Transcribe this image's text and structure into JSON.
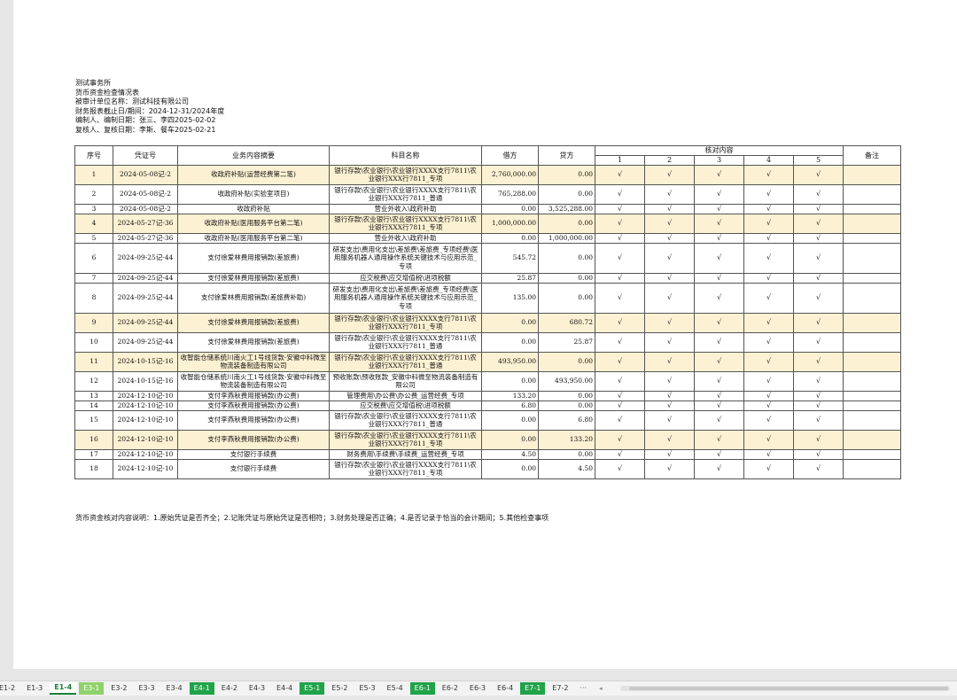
{
  "header": {
    "firm": "测试事务所",
    "title": "货币资金检查情况表",
    "entity": "被审计单位名称：测试科技有限公司",
    "period": "财务报表截止日/期间：2024-12-31/2024年度",
    "prepared": "编制人、编制日期：张三、李四2025-02-02",
    "reviewed": "复核人、复核日期：李斯、餐车2025-02-21"
  },
  "table": {
    "headers": {
      "seq": "序号",
      "voucher": "凭证号",
      "summary": "业务内容摘要",
      "account": "科目名称",
      "debit": "借方",
      "credit": "贷方",
      "check": "核对内容",
      "remark": "备注",
      "check_cols": [
        "1",
        "2",
        "3",
        "4",
        "5"
      ]
    },
    "check_mark": "√",
    "rows": [
      {
        "seq": "1",
        "voucher": "2024-05-08记-2",
        "summary": "收政府补贴(运营经费第二笔)",
        "account": "银行存款\\农业银行\\农业银行XXXX支行7811\\农业银行XXX行7811_专项",
        "debit": "2,760,000.00",
        "credit": "0.00",
        "remark": ""
      },
      {
        "seq": "2",
        "voucher": "2024-05-08记-2",
        "summary": "收政府补贴(实验室项目)",
        "account": "银行存款\\农业银行\\农业银行XXXX支行7811\\农业银行XXX行7811_普通",
        "debit": "765,288.00",
        "credit": "0.00",
        "remark": ""
      },
      {
        "seq": "3",
        "voucher": "2024-05-08记-2",
        "summary": "收政府补贴",
        "account": "营业外收入\\政府补助",
        "debit": "0.00",
        "credit": "3,525,288.00",
        "remark": ""
      },
      {
        "seq": "4",
        "voucher": "2024-05-27记-36",
        "summary": "收政府补贴(医用服务平台第二笔)",
        "account": "银行存款\\农业银行\\农业银行XXXX支行7811\\农业银行XXX行7811_专项",
        "debit": "1,000,000.00",
        "credit": "0.00",
        "remark": ""
      },
      {
        "seq": "5",
        "voucher": "2024-05-27记-36",
        "summary": "收政府补贴(医用服务平台第二笔)",
        "account": "营业外收入\\政府补助",
        "debit": "0.00",
        "credit": "1,000,000.00",
        "remark": ""
      },
      {
        "seq": "6",
        "voucher": "2024-09-25记-44",
        "summary": "支付徐爱林费用报销款(差旅费)",
        "account": "研发支出\\费用化支出\\差旅费\\差旅费_专项经费\\医用服务机器人通用操作系统关键技术与应用示范_专项",
        "debit": "545.72",
        "credit": "0.00",
        "remark": ""
      },
      {
        "seq": "7",
        "voucher": "2024-09-25记-44",
        "summary": "支付徐爱林费用报销款(差旅费)",
        "account": "应交税费\\应交增值税\\进项税额",
        "debit": "25.87",
        "credit": "0.00",
        "remark": ""
      },
      {
        "seq": "8",
        "voucher": "2024-09-25记-44",
        "summary": "支付徐爱林费用报销款(差旅费补助)",
        "account": "研发支出\\费用化支出\\差旅费\\差旅费_专项经费\\医用服务机器人通用操作系统关键技术与应用示范_专项",
        "debit": "135.00",
        "credit": "0.00",
        "remark": ""
      },
      {
        "seq": "9",
        "voucher": "2024-09-25记-44",
        "summary": "支付徐爱林费用报销款(差旅费)",
        "account": "银行存款\\农业银行\\农业银行XXXX支行7811\\农业银行XXX行7811_专项",
        "debit": "0.00",
        "credit": "680.72",
        "remark": ""
      },
      {
        "seq": "10",
        "voucher": "2024-09-25记-44",
        "summary": "支付徐爱林费用报销款(差旅费)",
        "account": "银行存款\\农业银行\\农业银行XXXX支行7811\\农业银行XXX行7811_普通",
        "debit": "0.00",
        "credit": "25.87",
        "remark": ""
      },
      {
        "seq": "11",
        "voucher": "2024-10-15记-16",
        "summary": "收智能仓储系统川南火工1号线货款-安徽中科微至物流装备制造有限公司",
        "account": "银行存款\\农业银行\\农业银行XXXX支行7811\\农业银行XXX行7811_普通",
        "debit": "493,950.00",
        "credit": "0.00",
        "remark": ""
      },
      {
        "seq": "12",
        "voucher": "2024-10-15记-16",
        "summary": "收智能仓储系统川南火工1号线货款-安徽中科微至物流装备制造有限公司",
        "account": "预收账款\\预收账款_安徽中科微至物流装备制造有限公司",
        "debit": "0.00",
        "credit": "493,950.00",
        "remark": ""
      },
      {
        "seq": "13",
        "voucher": "2024-12-10记-10",
        "summary": "支付李燕秋费用报销款(办公费)",
        "account": "管理费用\\办公费\\办公费_运营经费_专项",
        "debit": "133.20",
        "credit": "0.00",
        "remark": ""
      },
      {
        "seq": "14",
        "voucher": "2024-12-10记-10",
        "summary": "支付李燕秋费用报销款(办公费)",
        "account": "应交税费\\应交增值税\\进项税额",
        "debit": "6.80",
        "credit": "0.00",
        "remark": ""
      },
      {
        "seq": "15",
        "voucher": "2024-12-10记-10",
        "summary": "支付李燕秋费用报销款(办公费)",
        "account": "银行存款\\农业银行\\农业银行XXXX支行7811\\农业银行XXX行7811_普通",
        "debit": "0.00",
        "credit": "6.80",
        "remark": ""
      },
      {
        "seq": "16",
        "voucher": "2024-12-10记-10",
        "summary": "支付李燕秋费用报销款(办公费)",
        "account": "银行存款\\农业银行\\农业银行XXXX支行7811\\农业银行XXX行7811_专项",
        "debit": "0.00",
        "credit": "133.20",
        "remark": ""
      },
      {
        "seq": "17",
        "voucher": "2024-12-10记-10",
        "summary": "支付银行手续费",
        "account": "财务费用\\手续费\\手续费_运营经费_专项",
        "debit": "4.50",
        "credit": "0.00",
        "remark": ""
      },
      {
        "seq": "18",
        "voucher": "2024-12-10记-10",
        "summary": "支付银行手续费",
        "account": "银行存款\\农业银行\\农业银行XXXX支行7811\\农业银行XXX行7811_专项",
        "debit": "0.00",
        "credit": "4.50",
        "remark": ""
      }
    ]
  },
  "note": "货币资金核对内容说明：1.原始凭证是否齐全；2.记账凭证与原始凭证是否相符；3.财务处理是否正确；4.是否记录于恰当的会计期间；5.其他检查事项",
  "tabs": [
    "E1-2",
    "E1-3",
    "E1-4",
    "E3-1",
    "E3-2",
    "E3-3",
    "E3-4",
    "E4-1",
    "E4-2",
    "E4-3",
    "E4-4",
    "E5-1",
    "E5-2",
    "E5-3",
    "E5-4",
    "E6-1",
    "E6-2",
    "E6-3",
    "E6-4",
    "E7-1",
    "E7-2"
  ],
  "more_tabs": "···",
  "colors": {
    "highlight_row": "#fdf1d3",
    "tab_green": "#21a34a",
    "tab_light_green": "#8fd26a",
    "active_tab": "#1a7f37"
  }
}
